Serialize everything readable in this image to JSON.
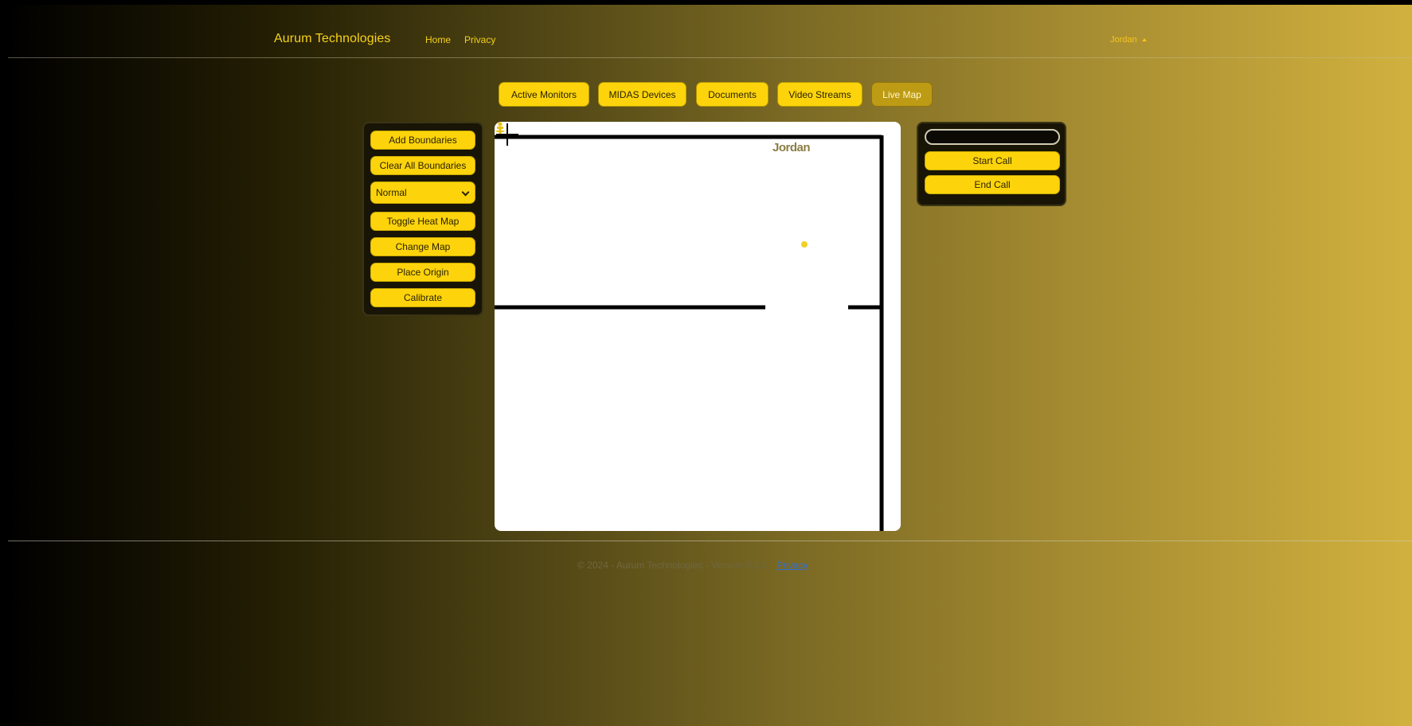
{
  "navbar": {
    "brand": "Aurum Technologies",
    "links": [
      "Home",
      "Privacy"
    ],
    "user": "Jordan"
  },
  "tabs": [
    {
      "label": "Active Monitors",
      "active": false
    },
    {
      "label": "MIDAS Devices",
      "active": false
    },
    {
      "label": "Documents",
      "active": false
    },
    {
      "label": "Video Streams",
      "active": false
    },
    {
      "label": "Live Map",
      "active": true
    }
  ],
  "tools": {
    "buttons": [
      "Add Boundaries",
      "Clear All Boundaries",
      "Toggle Heat Map",
      "Change Map",
      "Place Origin",
      "Calibrate"
    ],
    "select": {
      "value": "Normal"
    }
  },
  "map": {
    "marker_name": "Jordan",
    "marker_icon": "person-marker-icon",
    "crosshair_icon": "crosshair-icon"
  },
  "call": {
    "input_value": "",
    "buttons": [
      "Start Call",
      "End Call"
    ]
  },
  "footer": {
    "text": "© 2024 - Aurum Technologies - Version 0.1.3",
    "link": "Privacy"
  },
  "colors": {
    "accent": "#fdd40b",
    "active_tab": "#bd9b14",
    "panel": "#181506",
    "gradient_end": "#d1b13e"
  }
}
